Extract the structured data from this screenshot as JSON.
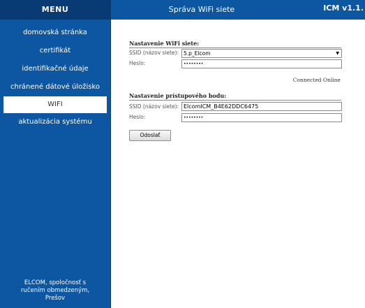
{
  "sidebar": {
    "title": "MENU",
    "items": [
      {
        "label": "domovská stránka"
      },
      {
        "label": "certifikát"
      },
      {
        "label": "identifikačné údaje"
      },
      {
        "label": "chránené dátové úložisko"
      },
      {
        "label": "WIFI",
        "active": true
      },
      {
        "label": "aktualizácia systému"
      }
    ],
    "company": "ELCOM, spoločnosť s ručením obmedzeným, Prešov"
  },
  "header": {
    "title": "Správa WiFi siete",
    "version": "ICM v1.1."
  },
  "wifi": {
    "title": "Nastavenie WiFi siete:",
    "ssid_label": "SSID (názov siete):",
    "ssid_value": "5.p_Elcom",
    "password_label": "Heslo:",
    "password_mask": "••••••••",
    "status": "Connected Online"
  },
  "ap": {
    "title": "Nastavenie prístupového bodu:",
    "ssid_label": "SSID (názov siete):",
    "ssid_value": "ElcomICM_B4E62DDC6475",
    "password_label": "Heslo:",
    "password_mask": "••••••••"
  },
  "submit_label": "Odoslať",
  "colors": {
    "primary": "#0d56a1",
    "menu_header": "#083a73"
  },
  "icons": {
    "select_arrow": "dropdown-arrow-icon"
  }
}
